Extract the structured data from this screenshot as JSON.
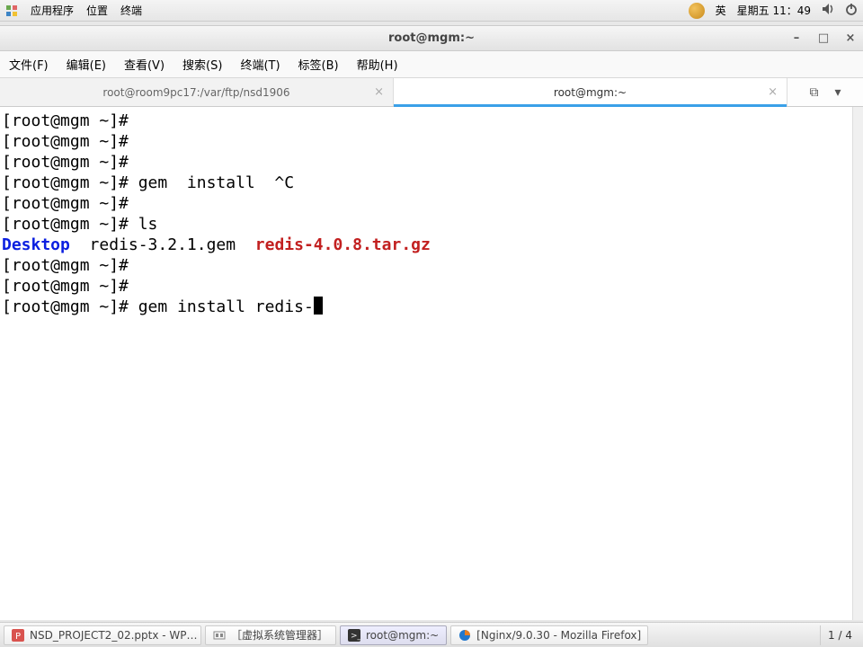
{
  "topbar": {
    "apps": "应用程序",
    "places": "位置",
    "terminal_label": "终端",
    "ime": "英",
    "clock": "星期五 11：49"
  },
  "window": {
    "title": "root@mgm:~"
  },
  "menus": {
    "file": "文件(F)",
    "edit": "编辑(E)",
    "view": "查看(V)",
    "search": "搜索(S)",
    "terminal": "终端(T)",
    "tabs": "标签(B)",
    "help": "帮助(H)"
  },
  "tabs": {
    "t0": "root@room9pc17:/var/ftp/nsd1906",
    "t1": "root@mgm:~"
  },
  "term": {
    "p1": "[root@mgm ~]#",
    "p2": "[root@mgm ~]#",
    "p3": "[root@mgm ~]#",
    "l4a": "[root@mgm ~]# gem  install  ^C",
    "p5": "[root@mgm ~]#",
    "l6": "[root@mgm ~]# ls",
    "ls_blue": "Desktop",
    "ls_gem": "  redis-3.2.1.gem  ",
    "ls_red": "redis-4.0.8.tar.gz",
    "p8": "[root@mgm ~]#",
    "p9": "[root@mgm ~]#",
    "l10": "[root@mgm ~]# gem install redis-"
  },
  "taskbar": {
    "b0": "NSD_PROJECT2_02.pptx - WP…",
    "b1": "［虚拟系统管理器］",
    "b2": "root@mgm:~",
    "b3": "[Nginx/9.0.30 - Mozilla Firefox]",
    "ws": "1 / 4"
  },
  "icons": {
    "sound": "sound-icon",
    "power": "power-icon",
    "min": "–",
    "max": "□",
    "close": "×",
    "tabclose": "×",
    "split": "⧉",
    "dropdown": "▾"
  }
}
